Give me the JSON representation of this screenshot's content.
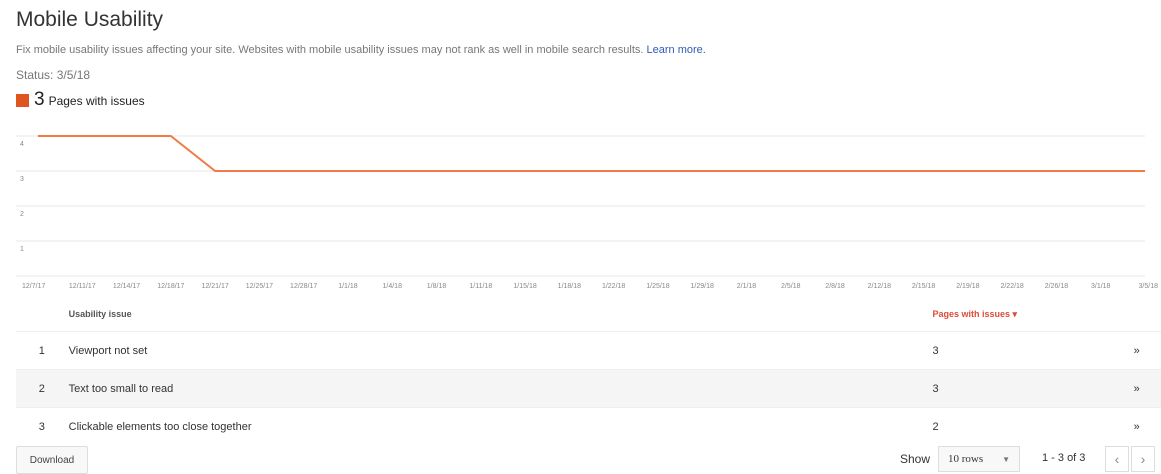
{
  "header": {
    "title": "Mobile Usability",
    "description": "Fix mobile usability issues affecting your site. Websites with mobile usability issues may not rank as well in mobile search results.",
    "learn_more": "Learn more.",
    "status": "Status: 3/5/18"
  },
  "legend": {
    "count": "3",
    "label": "Pages with issues",
    "color": "#e0551f"
  },
  "chart_data": {
    "type": "line",
    "series": [
      {
        "color": "#f07c45",
        "points": [
          {
            "x": "12/7/17",
            "y": 4
          },
          {
            "x": "12/18/17",
            "y": 4
          },
          {
            "x": "12/21/17",
            "y": 3
          },
          {
            "x": "3/5/18",
            "y": 3
          }
        ]
      }
    ],
    "x_ticks": [
      "12/7/17",
      "12/11/17",
      "12/14/17",
      "12/18/17",
      "12/21/17",
      "12/25/17",
      "12/28/17",
      "1/1/18",
      "1/4/18",
      "1/8/18",
      "1/11/18",
      "1/15/18",
      "1/18/18",
      "1/22/18",
      "1/25/18",
      "1/29/18",
      "2/1/18",
      "2/5/18",
      "2/8/18",
      "2/12/18",
      "2/15/18",
      "2/19/18",
      "2/22/18",
      "2/26/18",
      "3/1/18",
      "3/5/18"
    ],
    "y_ticks": [
      1,
      2,
      3,
      4
    ],
    "ylim": [
      0,
      4
    ],
    "grid": true
  },
  "table": {
    "headers": {
      "issue": "Usability issue",
      "pages": "Pages with issues ▾"
    },
    "rows": [
      {
        "num": "1",
        "issue": "Viewport not set",
        "pages": "3",
        "arrow": "»"
      },
      {
        "num": "2",
        "issue": "Text too small to read",
        "pages": "3",
        "arrow": "»"
      },
      {
        "num": "3",
        "issue": "Clickable elements too close together",
        "pages": "2",
        "arrow": "»"
      }
    ]
  },
  "footer": {
    "download": "Download",
    "show": "Show",
    "rows_value": "10 rows",
    "range": "1 - 3 of 3",
    "prev_icon": "chevron-left-icon",
    "next_icon": "chevron-right-icon"
  }
}
